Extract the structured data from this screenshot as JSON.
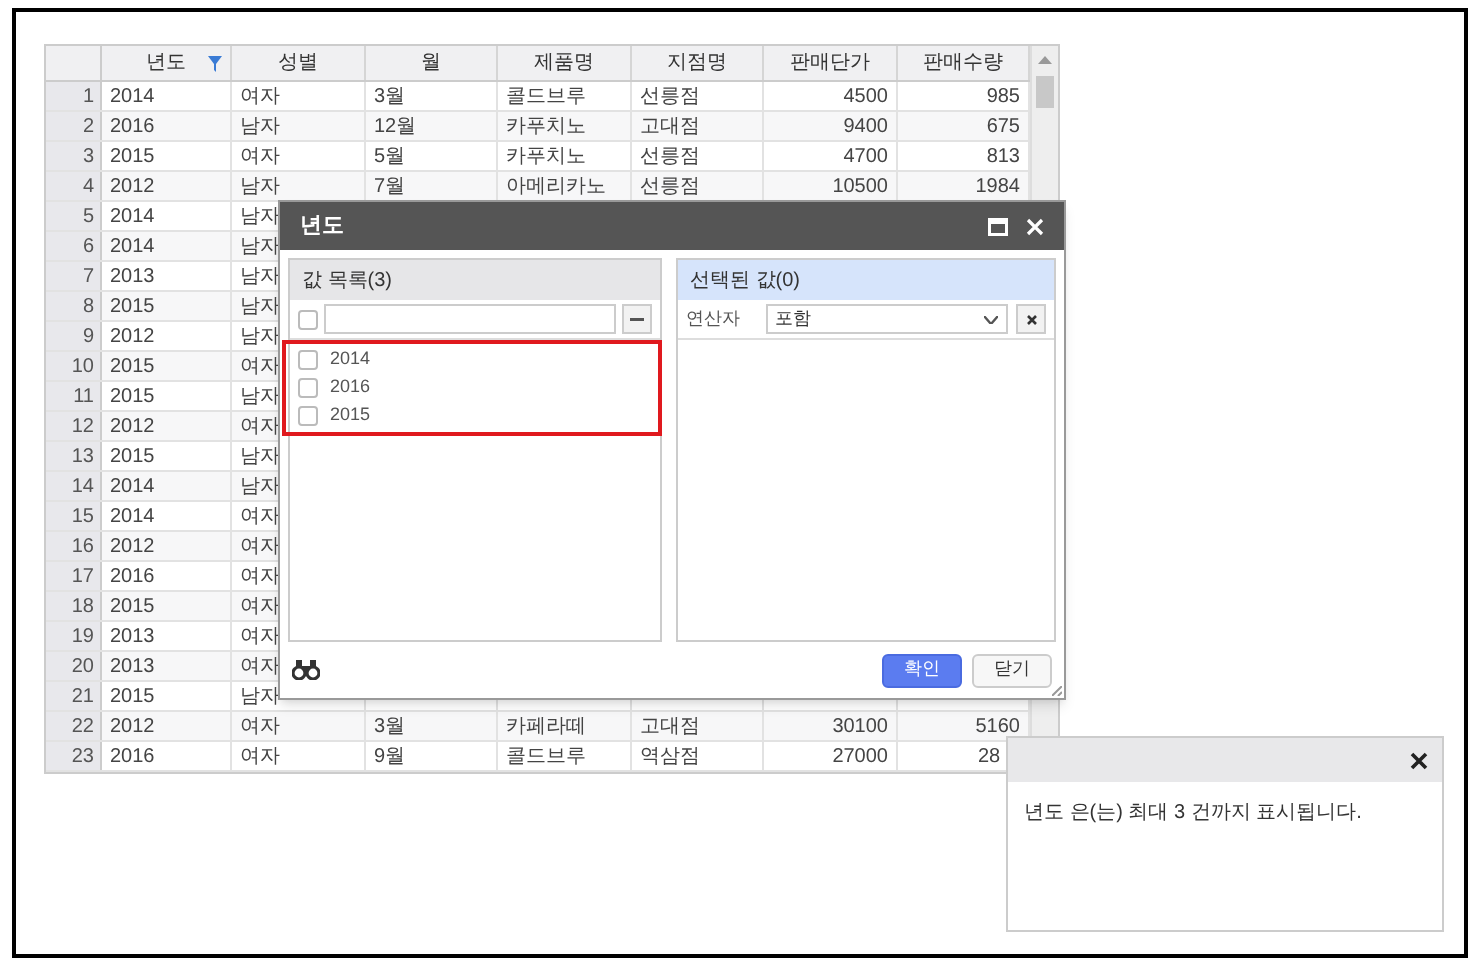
{
  "grid": {
    "columns": [
      {
        "label": "년도",
        "filtered": true
      },
      {
        "label": "성별",
        "filtered": false
      },
      {
        "label": "월",
        "filtered": false
      },
      {
        "label": "제품명",
        "filtered": false
      },
      {
        "label": "지점명",
        "filtered": false
      },
      {
        "label": "판매단가",
        "filtered": false
      },
      {
        "label": "판매수량",
        "filtered": false
      }
    ],
    "rows": [
      {
        "number": "1",
        "cells": [
          "2014",
          "여자",
          "3월",
          "콜드브루",
          "선릉점",
          "4500",
          "985"
        ]
      },
      {
        "number": "2",
        "cells": [
          "2016",
          "남자",
          "12월",
          "카푸치노",
          "고대점",
          "9400",
          "675"
        ]
      },
      {
        "number": "3",
        "cells": [
          "2015",
          "여자",
          "5월",
          "카푸치노",
          "선릉점",
          "4700",
          "813"
        ]
      },
      {
        "number": "4",
        "cells": [
          "2012",
          "남자",
          "7월",
          "아메리카노",
          "선릉점",
          "10500",
          "1984"
        ]
      },
      {
        "number": "5",
        "cells": [
          "2014",
          "남자"
        ]
      },
      {
        "number": "6",
        "cells": [
          "2014",
          "남자"
        ]
      },
      {
        "number": "7",
        "cells": [
          "2013",
          "남자"
        ]
      },
      {
        "number": "8",
        "cells": [
          "2015",
          "남자"
        ]
      },
      {
        "number": "9",
        "cells": [
          "2012",
          "남자"
        ]
      },
      {
        "number": "10",
        "cells": [
          "2015",
          "여자"
        ]
      },
      {
        "number": "11",
        "cells": [
          "2015",
          "남자"
        ]
      },
      {
        "number": "12",
        "cells": [
          "2012",
          "여자"
        ]
      },
      {
        "number": "13",
        "cells": [
          "2015",
          "남자"
        ]
      },
      {
        "number": "14",
        "cells": [
          "2014",
          "남자"
        ]
      },
      {
        "number": "15",
        "cells": [
          "2014",
          "여자"
        ]
      },
      {
        "number": "16",
        "cells": [
          "2012",
          "여자"
        ]
      },
      {
        "number": "17",
        "cells": [
          "2016",
          "여자"
        ]
      },
      {
        "number": "18",
        "cells": [
          "2015",
          "여자"
        ]
      },
      {
        "number": "19",
        "cells": [
          "2013",
          "여자"
        ]
      },
      {
        "number": "20",
        "cells": [
          "2013",
          "여자"
        ]
      },
      {
        "number": "21",
        "cells": [
          "2015",
          "남자"
        ]
      },
      {
        "number": "22",
        "cells": [
          "2012",
          "여자",
          "3월",
          "카페라떼",
          "고대점",
          "30100",
          "5160"
        ]
      },
      {
        "number": "23",
        "cells": [
          "2016",
          "여자",
          "9월",
          "콜드브루",
          "역삼점",
          "27000",
          "28"
        ],
        "partly_hidden": true
      }
    ]
  },
  "dialog": {
    "title": "년도",
    "values_panel": {
      "title": "값 목록(3)",
      "select_all_checked": false,
      "highlighted": true,
      "items": [
        {
          "label": "2014",
          "checked": false
        },
        {
          "label": "2016",
          "checked": false
        },
        {
          "label": "2015",
          "checked": false
        }
      ]
    },
    "selected_panel": {
      "title": "선택된 값(0)",
      "operator_label": "연산자",
      "operator_value": "포함"
    },
    "buttons": [
      {
        "label": "확인",
        "kind": "primary"
      },
      {
        "label": "닫기",
        "kind": "secondary"
      }
    ]
  },
  "toast": {
    "message": "년도 은(는) 최대 3 건까지 표시됩니다."
  }
}
